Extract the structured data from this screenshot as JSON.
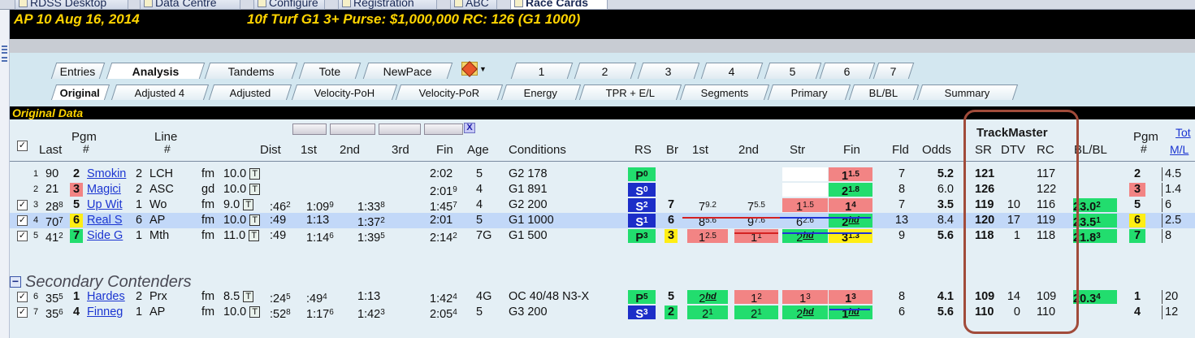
{
  "top_menu": [
    {
      "label": "RDSS Desktop",
      "icon": "desktop-icon"
    },
    {
      "label": "Data Centre",
      "icon": "folder-icon"
    },
    {
      "label": "Configure",
      "icon": "gear-icon"
    },
    {
      "label": "Registration",
      "icon": "key-icon"
    },
    {
      "label": "ABC",
      "icon": "abc-icon"
    },
    {
      "label": "Race Cards",
      "icon": "cards-icon",
      "active": true
    }
  ],
  "race_header": {
    "track_date": "AP 10  Aug 16, 2014",
    "details": "10f Turf G1  3+  Purse: $1,000,000  RC: 126 (G1 1000)"
  },
  "primary_tabs": [
    "Entries",
    "Analysis",
    "Tandems",
    "Tote",
    "NewPace",
    "1",
    "2",
    "3",
    "4",
    "5",
    "6",
    "7"
  ],
  "active_primary_tab": "Analysis",
  "secondary_tabs": [
    "Original",
    "Adjusted 4",
    "Adjusted",
    "Velocity-PoH",
    "Velocity-PoR",
    "Energy",
    "TPR + E/L",
    "Segments",
    "Primary",
    "BL/BL",
    "Summary"
  ],
  "active_secondary_tab": "Original",
  "section_title": "Original Data",
  "headers": {
    "check": "✓",
    "last": "Last",
    "pgm": "Pgm",
    "pgm_hash": "#",
    "line": "Line",
    "line_hash": "#",
    "dist": "Dist",
    "first": "1st",
    "second": "2nd",
    "third": "3rd",
    "fin": "Fin",
    "age": "Age",
    "conditions": "Conditions",
    "rs": "RS",
    "br": "Br",
    "c1st": "1st",
    "c2nd": "2nd",
    "str": "Str",
    "cfin": "Fin",
    "fld": "Fld",
    "odds": "Odds",
    "trackmaster": "TrackMaster",
    "sr": "SR",
    "dtv": "DTV",
    "rc": "RC",
    "blbl": "BL/BL",
    "pgm2": "Pgm",
    "pgm2_hash": "#",
    "tot": "Tot",
    "ml": "M/L",
    "x_label": "X"
  },
  "rows": [
    {
      "idx": "1",
      "checked": false,
      "last": "90",
      "last_sup": "",
      "pgm": "2",
      "pgm_bg": "",
      "horse": "Smokin",
      "line": "2",
      "line_trk": "LCH",
      "surf": "fm",
      "dist": "10.0",
      "f1": "",
      "f1s": "",
      "f2": "",
      "f2s": "",
      "f3": "",
      "f3s": "",
      "fin": "2:02",
      "fins": "",
      "age": "5",
      "cond": "G2 178",
      "rs": "P",
      "rs_sup": "0",
      "rs_bg": "green",
      "br": "",
      "br_bg": "",
      "c1": "",
      "c1s": "",
      "c1_bg": "",
      "c2": "",
      "c2s": "",
      "c2_bg": "",
      "cst": "",
      "csts": "",
      "cst_bg": "white",
      "cfin": "1",
      "cfins": "1.5",
      "cfin_bg": "red",
      "fld": "7",
      "odds": "5.2",
      "odds_bold": true,
      "sr": "121",
      "dtv": "",
      "rc": "117",
      "blbl": "",
      "blbl_sup": "",
      "pgm2": "2",
      "pgm2_bg": "",
      "ml": "4.5"
    },
    {
      "idx": "2",
      "checked": false,
      "last": "21",
      "last_sup": "",
      "pgm": "3",
      "pgm_bg": "red",
      "horse": "Magici",
      "line": "2",
      "line_trk": "ASC",
      "surf": "gd",
      "dist": "10.0",
      "f1": "",
      "f1s": "",
      "f2": "",
      "f2s": "",
      "f3": "",
      "f3s": "",
      "fin": "2:01",
      "fins": "9",
      "age": "4",
      "cond": "G1 891",
      "rs": "S",
      "rs_sup": "0",
      "rs_bg": "blue",
      "br": "",
      "br_bg": "",
      "c1": "",
      "c1s": "",
      "c1_bg": "",
      "c2": "",
      "c2s": "",
      "c2_bg": "",
      "cst": "",
      "csts": "",
      "cst_bg": "white",
      "cfin": "2",
      "cfins": "1.8",
      "cfin_bg": "green",
      "fld": "8",
      "odds": "6.0",
      "odds_bold": false,
      "sr": "126",
      "dtv": "",
      "rc": "122",
      "blbl": "",
      "blbl_sup": "",
      "pgm2": "3",
      "pgm2_bg": "red",
      "ml": "1.4"
    },
    {
      "idx": "3",
      "checked": true,
      "last": "28",
      "last_sup": "8",
      "pgm": "5",
      "pgm_bg": "",
      "horse": "Up Wit",
      "line": "1",
      "line_trk": "Wo",
      "surf": "fm",
      "dist": "9.0",
      "f1": ":46",
      "f1s": "2",
      "f2": "1:09",
      "f2s": "9",
      "f3": "1:33",
      "f3s": "8",
      "fin": "1:45",
      "fins": "7",
      "age": "4",
      "cond": "G2 200",
      "rs": "S",
      "rs_sup": "2",
      "rs_bg": "blue",
      "br": "7",
      "br_bg": "",
      "c1": "7",
      "c1s": "9.2",
      "c1_bg": "",
      "c2": "7",
      "c2s": "5.5",
      "c2_bg": "",
      "cst": "1",
      "csts": "1.5",
      "cst_bg": "red",
      "cfin": "1",
      "cfins": "4",
      "cfin_bg": "red",
      "fld": "7",
      "odds": "3.5",
      "odds_bold": true,
      "sr": "119",
      "dtv": "10",
      "rc": "116",
      "blbl": "23.0",
      "blbl_sup": "2",
      "pgm2": "5",
      "pgm2_bg": "",
      "ml": "6"
    },
    {
      "idx": "4",
      "checked": true,
      "last": "70",
      "last_sup": "7",
      "pgm": "6",
      "pgm_bg": "yellow",
      "horse": "Real S",
      "line": "6",
      "line_trk": "AP",
      "surf": "fm",
      "dist": "10.0",
      "f1": ":49",
      "f1s": "",
      "f2": "1:13",
      "f2s": "",
      "f3": "1:37",
      "f3s": "2",
      "fin": "2:01",
      "fins": "",
      "age": "5",
      "cond": "G1 1000",
      "rs": "S",
      "rs_sup": "1",
      "rs_bg": "blue",
      "br": "6",
      "br_bg": "",
      "c1": "8",
      "c1s": "5.6",
      "c1_bg": "",
      "c2": "9",
      "c2s": "7.6",
      "c2_bg": "",
      "cst": "6",
      "csts": "2.6",
      "cst_bg": "",
      "cfin": "2",
      "cfins": "hd",
      "cfin_bg": "green",
      "fld": "13",
      "odds": "8.4",
      "odds_bold": false,
      "sr": "120",
      "dtv": "17",
      "rc": "119",
      "blbl": "23.5",
      "blbl_sup": "1",
      "pgm2": "6",
      "pgm2_bg": "yellow",
      "ml": "2.5"
    },
    {
      "idx": "5",
      "checked": true,
      "last": "41",
      "last_sup": "2",
      "pgm": "7",
      "pgm_bg": "green",
      "horse": "Side G",
      "line": "1",
      "line_trk": "Mth",
      "surf": "fm",
      "dist": "11.0",
      "f1": ":49",
      "f1s": "",
      "f2": "1:14",
      "f2s": "6",
      "f3": "1:39",
      "f3s": "5",
      "fin": "2:14",
      "fins": "2",
      "age": "7G",
      "cond": "G1 500",
      "rs": "P",
      "rs_sup": "3",
      "rs_bg": "green",
      "br": "3",
      "br_bg": "yellow",
      "c1": "1",
      "c1s": "2.5",
      "c1_bg": "red",
      "c2": "1",
      "c2s": "1",
      "c2_bg": "red",
      "cst": "2",
      "csts": "hd",
      "cst_bg": "green",
      "cfin": "3",
      "cfins": "1.3",
      "cfin_bg": "yellow",
      "fld": "9",
      "odds": "5.6",
      "odds_bold": true,
      "sr": "118",
      "dtv": "1",
      "rc": "118",
      "blbl": "21.8",
      "blbl_sup": "3",
      "pgm2": "7",
      "pgm2_bg": "green",
      "ml": "8"
    },
    {
      "idx": "6",
      "checked": true,
      "last": "35",
      "last_sup": "5",
      "pgm": "1",
      "pgm_bg": "",
      "horse": "Hardes",
      "line": "2",
      "line_trk": "Prx",
      "surf": "fm",
      "dist": "8.5",
      "f1": ":24",
      "f1s": "5",
      "f2": ":49",
      "f2s": "4",
      "f3": "1:13",
      "f3s": "",
      "fin": "1:42",
      "fins": "4",
      "age": "4G",
      "cond": "OC 40/48 N3-X",
      "rs": "P",
      "rs_sup": "5",
      "rs_bg": "green",
      "br": "5",
      "br_bg": "",
      "c1": "2",
      "c1s": "hd",
      "c1_bg": "green",
      "c2": "1",
      "c2s": "2",
      "c2_bg": "red",
      "cst": "1",
      "csts": "3",
      "cst_bg": "red",
      "cfin": "1",
      "cfins": "3",
      "cfin_bg": "red",
      "fld": "8",
      "odds": "4.1",
      "odds_bold": true,
      "sr": "109",
      "dtv": "14",
      "rc": "109",
      "blbl": "20.3",
      "blbl_sup": "4",
      "pgm2": "1",
      "pgm2_bg": "",
      "ml": "20"
    },
    {
      "idx": "7",
      "checked": true,
      "last": "35",
      "last_sup": "6",
      "pgm": "4",
      "pgm_bg": "",
      "horse": "Finneg",
      "line": "1",
      "line_trk": "AP",
      "surf": "fm",
      "dist": "10.0",
      "f1": ":52",
      "f1s": "8",
      "f2": "1:17",
      "f2s": "6",
      "f3": "1:42",
      "f3s": "3",
      "fin": "2:05",
      "fins": "4",
      "age": "5",
      "cond": "G3 200",
      "rs": "S",
      "rs_sup": "3",
      "rs_bg": "blue",
      "br": "2",
      "br_bg": "green",
      "c1": "2",
      "c1s": "1",
      "c1_bg": "green",
      "c2": "2",
      "c2s": "1",
      "c2_bg": "green",
      "cst": "2",
      "csts": "hd",
      "cst_bg": "green",
      "cfin": "1",
      "cfins": "hd",
      "cfin_bg": "green",
      "fld": "6",
      "odds": "5.6",
      "odds_bold": true,
      "sr": "110",
      "dtv": "0",
      "rc": "110",
      "blbl": "",
      "blbl_sup": "",
      "pgm2": "4",
      "pgm2_bg": "",
      "ml": "12"
    }
  ],
  "secondary_label": "Secondary Contenders",
  "colors": {
    "green": "#22dd6e",
    "yellow": "#ffee14",
    "red": "#f28484",
    "blue": "#1c2ec8",
    "highlight_row": "#c2d8f8",
    "header_yellow": "#ffd400"
  }
}
